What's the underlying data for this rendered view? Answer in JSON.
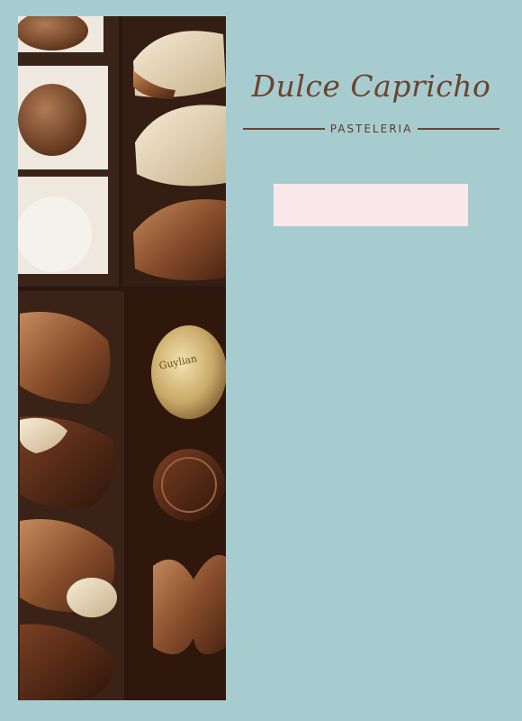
{
  "brand": {
    "name": "Dulce Capricho",
    "subtitle": "PASTELERIA"
  },
  "photo": {
    "wrapper_text": "Guylian"
  },
  "colors": {
    "background": "#a7ccd0",
    "brand_text": "#6b4430",
    "pink_box": "#f9e7e9",
    "chocolate_tray": "#2a1710"
  }
}
